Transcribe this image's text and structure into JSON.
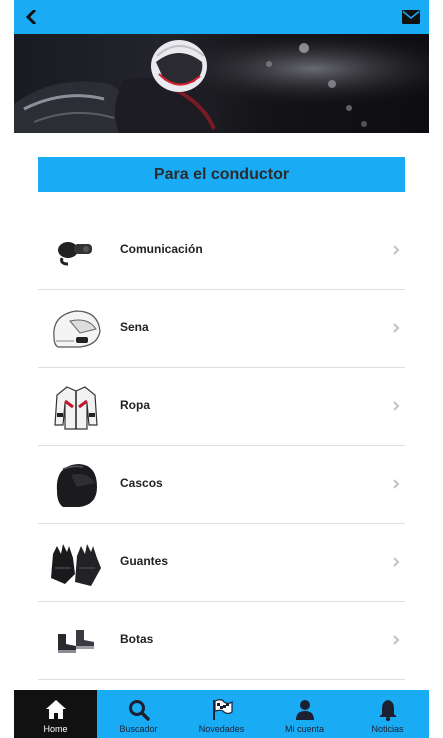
{
  "header": {
    "back_icon": "chevron-left-icon",
    "mail_icon": "envelope-icon"
  },
  "hero": {
    "image": "motorcycle-rider-helmet-photo"
  },
  "section": {
    "title": "Para el conductor"
  },
  "list": {
    "items": [
      {
        "label": "Comunicación",
        "icon": "intercom-device-icon"
      },
      {
        "label": "Sena",
        "icon": "sena-helmet-icon"
      },
      {
        "label": "Ropa",
        "icon": "jacket-icon"
      },
      {
        "label": "Cascos",
        "icon": "helmet-icon"
      },
      {
        "label": "Guantes",
        "icon": "gloves-icon"
      },
      {
        "label": "Botas",
        "icon": "boots-icon"
      }
    ]
  },
  "nav": {
    "tabs": [
      {
        "label": "Home",
        "icon": "home-icon",
        "active": true
      },
      {
        "label": "Buscador",
        "icon": "search-icon",
        "active": false
      },
      {
        "label": "Novedades",
        "icon": "flag-icon",
        "active": false
      },
      {
        "label": "Mi cuenta",
        "icon": "user-icon",
        "active": false
      },
      {
        "label": "Noticias",
        "icon": "bell-icon",
        "active": false
      }
    ]
  },
  "colors": {
    "primary": "#1aabf5",
    "nav_active": "#111111"
  }
}
